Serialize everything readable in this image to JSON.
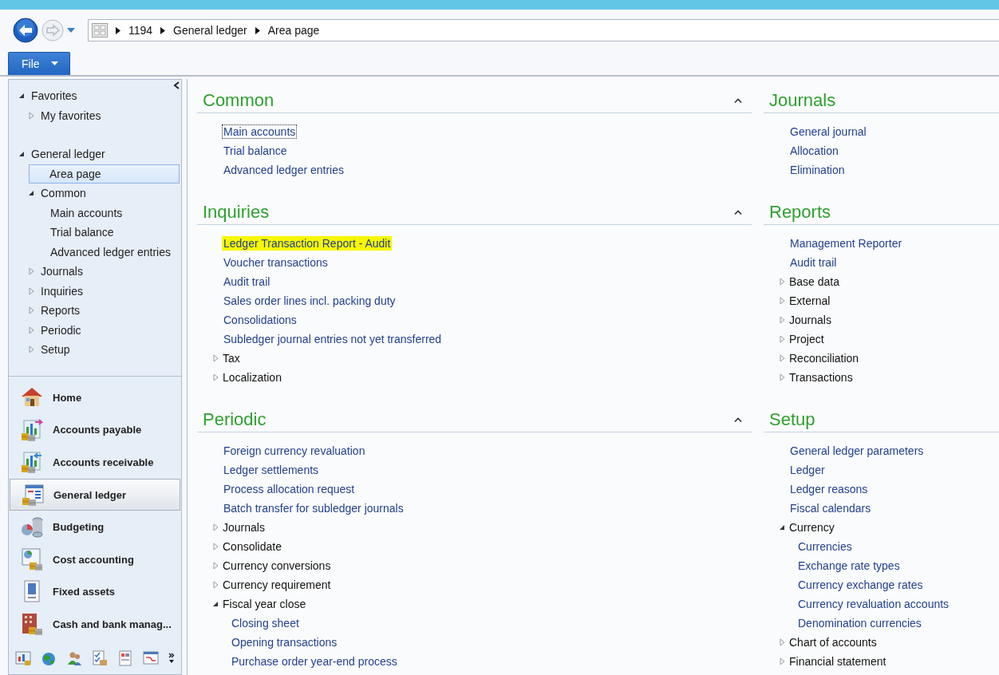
{
  "breadcrumb": [
    "1194",
    "General ledger",
    "Area page"
  ],
  "file_menu": {
    "label": "File"
  },
  "nav_tree": [
    {
      "label": "Favorites",
      "kind": "folder",
      "expanded": true,
      "selected": false,
      "children": [
        {
          "label": "My favorites",
          "kind": "folder",
          "expanded": false,
          "selected": false
        }
      ]
    },
    {
      "label": "General ledger",
      "kind": "folder",
      "expanded": true,
      "selected": false,
      "children": [
        {
          "label": "Area page",
          "kind": "page",
          "selected": true
        },
        {
          "label": "Common",
          "kind": "folder",
          "expanded": true,
          "selected": false,
          "children": [
            {
              "label": "Main accounts",
              "kind": "page",
              "selected": false
            },
            {
              "label": "Trial balance",
              "kind": "page",
              "selected": false
            },
            {
              "label": "Advanced ledger entries",
              "kind": "page",
              "selected": false
            }
          ]
        },
        {
          "label": "Journals",
          "kind": "folder",
          "expanded": false,
          "selected": false
        },
        {
          "label": "Inquiries",
          "kind": "folder",
          "expanded": false,
          "selected": false
        },
        {
          "label": "Reports",
          "kind": "folder",
          "expanded": false,
          "selected": false
        },
        {
          "label": "Periodic",
          "kind": "folder",
          "expanded": false,
          "selected": false
        },
        {
          "label": "Setup",
          "kind": "folder",
          "expanded": false,
          "selected": false
        }
      ]
    }
  ],
  "modules": [
    {
      "label": "Home",
      "selected": false
    },
    {
      "label": "Accounts payable",
      "selected": false
    },
    {
      "label": "Accounts receivable",
      "selected": false
    },
    {
      "label": "General ledger",
      "selected": true
    },
    {
      "label": "Budgeting",
      "selected": false
    },
    {
      "label": "Cost accounting",
      "selected": false
    },
    {
      "label": "Fixed assets",
      "selected": false
    },
    {
      "label": "Cash and bank manag...",
      "selected": false
    }
  ],
  "left_column": [
    {
      "title": "Common",
      "items": [
        {
          "label": "Main accounts",
          "kind": "link",
          "focused": true,
          "highlighted": false
        },
        {
          "label": "Trial balance",
          "kind": "link",
          "focused": false,
          "highlighted": false
        },
        {
          "label": "Advanced ledger entries",
          "kind": "link",
          "focused": false,
          "highlighted": false
        }
      ]
    },
    {
      "title": "Inquiries",
      "items": [
        {
          "label": "Ledger Transaction Report - Audit",
          "kind": "link",
          "focused": false,
          "highlighted": true
        },
        {
          "label": "Voucher transactions",
          "kind": "link",
          "focused": false,
          "highlighted": false
        },
        {
          "label": "Audit trail",
          "kind": "link",
          "focused": false,
          "highlighted": false
        },
        {
          "label": "Sales order lines incl. packing duty",
          "kind": "link",
          "focused": false,
          "highlighted": false
        },
        {
          "label": "Consolidations",
          "kind": "link",
          "focused": false,
          "highlighted": false
        },
        {
          "label": "Subledger journal entries not yet transferred",
          "kind": "link",
          "focused": false,
          "highlighted": false
        },
        {
          "label": "Tax",
          "kind": "folder",
          "expanded": false
        },
        {
          "label": "Localization",
          "kind": "folder",
          "expanded": false
        }
      ]
    },
    {
      "title": "Periodic",
      "items": [
        {
          "label": "Foreign currency revaluation",
          "kind": "link"
        },
        {
          "label": "Ledger settlements",
          "kind": "link"
        },
        {
          "label": "Process allocation request",
          "kind": "link"
        },
        {
          "label": "Batch transfer for subledger journals",
          "kind": "link"
        },
        {
          "label": "Journals",
          "kind": "folder",
          "expanded": false
        },
        {
          "label": "Consolidate",
          "kind": "folder",
          "expanded": false
        },
        {
          "label": "Currency conversions",
          "kind": "folder",
          "expanded": false
        },
        {
          "label": "Currency requirement",
          "kind": "folder",
          "expanded": false
        },
        {
          "label": "Fiscal year close",
          "kind": "folder",
          "expanded": true,
          "children": [
            {
              "label": "Closing sheet",
              "kind": "link"
            },
            {
              "label": "Opening transactions",
              "kind": "link"
            },
            {
              "label": "Purchase order year-end process",
              "kind": "link"
            }
          ]
        }
      ]
    }
  ],
  "right_column": [
    {
      "title": "Journals",
      "items": [
        {
          "label": "General journal",
          "kind": "link"
        },
        {
          "label": "Allocation",
          "kind": "link"
        },
        {
          "label": "Elimination",
          "kind": "link"
        }
      ]
    },
    {
      "title": "Reports",
      "items": [
        {
          "label": "Management Reporter",
          "kind": "link"
        },
        {
          "label": "Audit trail",
          "kind": "link"
        },
        {
          "label": "Base data",
          "kind": "folder",
          "expanded": false
        },
        {
          "label": "External",
          "kind": "folder",
          "expanded": false
        },
        {
          "label": "Journals",
          "kind": "folder",
          "expanded": false
        },
        {
          "label": "Project",
          "kind": "folder",
          "expanded": false
        },
        {
          "label": "Reconciliation",
          "kind": "folder",
          "expanded": false
        },
        {
          "label": "Transactions",
          "kind": "folder",
          "expanded": false
        }
      ]
    },
    {
      "title": "Setup",
      "items": [
        {
          "label": "General ledger parameters",
          "kind": "link"
        },
        {
          "label": "Ledger",
          "kind": "link"
        },
        {
          "label": "Ledger reasons",
          "kind": "link"
        },
        {
          "label": "Fiscal calendars",
          "kind": "link"
        },
        {
          "label": "Currency",
          "kind": "folder",
          "expanded": true,
          "children": [
            {
              "label": "Currencies",
              "kind": "link"
            },
            {
              "label": "Exchange rate types",
              "kind": "link"
            },
            {
              "label": "Currency exchange rates",
              "kind": "link"
            },
            {
              "label": "Currency revaluation accounts",
              "kind": "link"
            },
            {
              "label": "Denomination currencies",
              "kind": "link"
            }
          ]
        },
        {
          "label": "Chart of accounts",
          "kind": "folder",
          "expanded": false
        },
        {
          "label": "Financial statement",
          "kind": "folder",
          "expanded": false
        }
      ]
    }
  ]
}
